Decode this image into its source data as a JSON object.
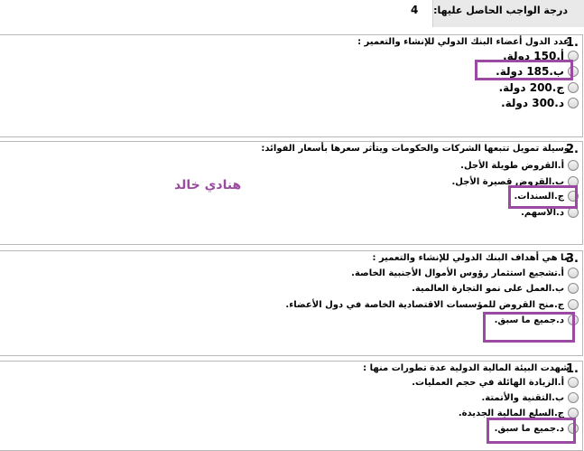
{
  "grade": {
    "label": "درجة الواجب الحاصل عليها:",
    "value": "4"
  },
  "watermark": "هنادي خالد",
  "questions": [
    {
      "num": "1.",
      "text": "عدد الدول أعضاء البنك الدولي للإنشاء والتعمير :",
      "options": [
        "أ.150 دولة.",
        "ب.185 دولة.",
        "ج.200 دولة.",
        "د.300 دولة."
      ]
    },
    {
      "num": "2.",
      "text": "وسيلة تمويل تتبعها الشركات والحكومات ويتأثر سعرها بأسعار الفوائد:",
      "options": [
        "أ.القروض طويلة الأجل.",
        "ب.القروض قصيرة الأجل.",
        "ج.السندات.",
        "د.الأسهم."
      ]
    },
    {
      "num": "3.",
      "text": "ما هي أهداف البنك الدولي للإنشاء والتعمير :",
      "options": [
        "أ.تشجيع استثمار رؤوس الأموال الأجنبية الخاصة.",
        "ب.العمل على نمو التجارة العالمية.",
        "ج.منح القروض للمؤسسات الاقتصادية الخاصة في دول الأعضاء.",
        "د.جميع ما سبق."
      ]
    },
    {
      "num": "1.",
      "text": "شهدت البيئة المالية الدولية عدة تطورات منها :",
      "options": [
        "أ.الزيادة الهائلة في حجم العمليات.",
        "ب.التقنية والأتمتة.",
        "ج.السلع المالية الجديدة.",
        "د.جميع ما سبق."
      ]
    }
  ],
  "colors": {
    "highlight": "#9a4aa0",
    "header_bg": "#e9e9e9",
    "border": "#b8b8b8"
  }
}
